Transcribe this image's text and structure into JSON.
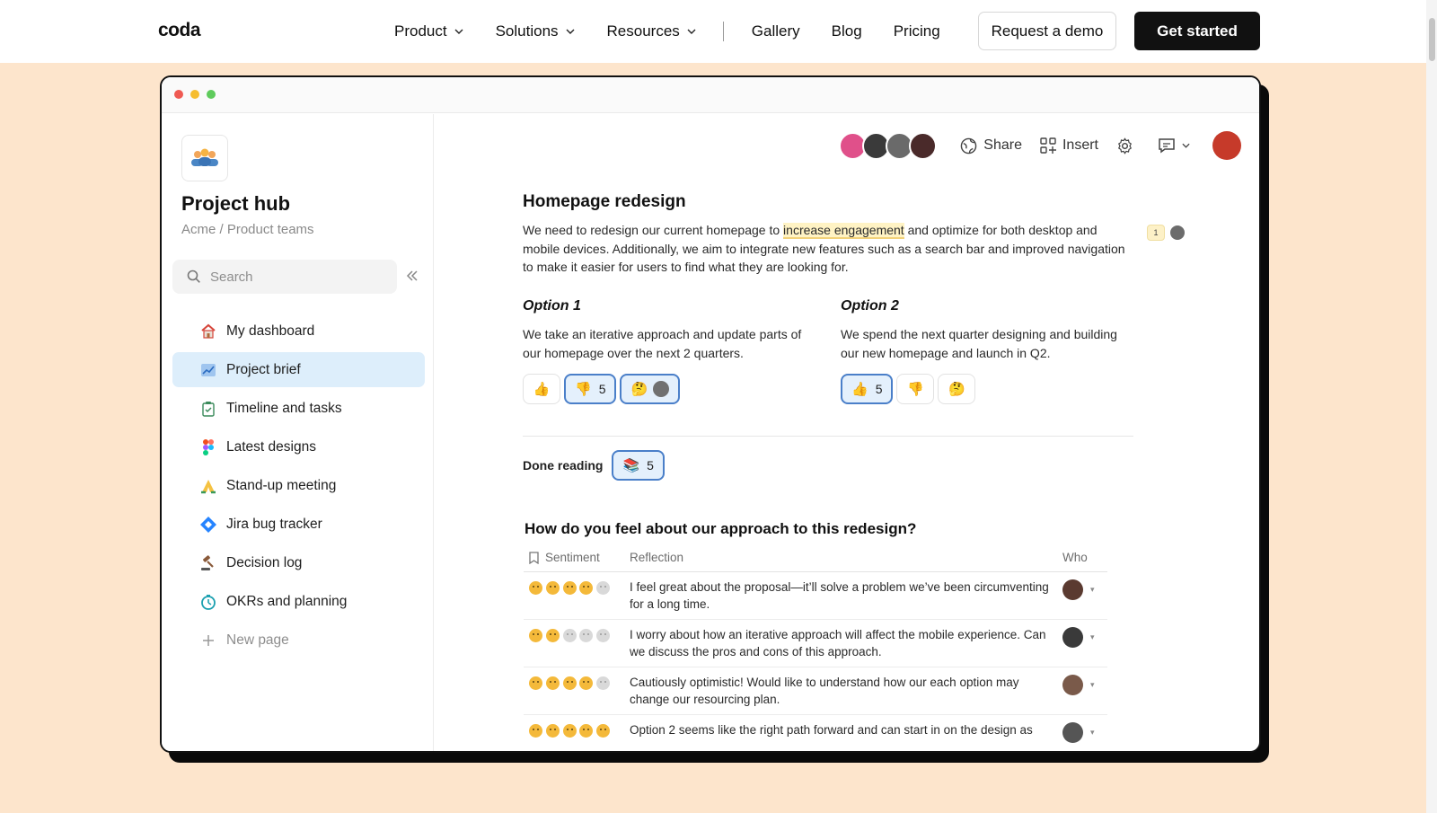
{
  "nav": {
    "logo": "coda",
    "links": [
      {
        "label": "Product",
        "dropdown": true
      },
      {
        "label": "Solutions",
        "dropdown": true
      },
      {
        "label": "Resources",
        "dropdown": true
      },
      {
        "label": "Gallery",
        "dropdown": false
      },
      {
        "label": "Blog",
        "dropdown": false
      },
      {
        "label": "Pricing",
        "dropdown": false
      }
    ],
    "demo_label": "Request a demo",
    "start_label": "Get started"
  },
  "sidebar": {
    "doc_title": "Project hub",
    "doc_subtitle": "Acme / Product teams",
    "search_placeholder": "Search",
    "items": [
      {
        "label": "My dashboard",
        "icon": "house-icon",
        "active": false
      },
      {
        "label": "Project brief",
        "icon": "chart-icon",
        "active": true
      },
      {
        "label": "Timeline and tasks",
        "icon": "clipboard-icon",
        "active": false
      },
      {
        "label": "Latest designs",
        "icon": "figma-icon",
        "active": false
      },
      {
        "label": "Stand-up meeting",
        "icon": "praying-hands-icon",
        "active": false
      },
      {
        "label": "Jira bug tracker",
        "icon": "jira-icon",
        "active": false
      },
      {
        "label": "Decision log",
        "icon": "gavel-icon",
        "active": false
      },
      {
        "label": "OKRs and planning",
        "icon": "stopwatch-icon",
        "active": false
      }
    ],
    "new_page_label": "New page"
  },
  "toolbar": {
    "share_label": "Share",
    "insert_label": "Insert"
  },
  "doc": {
    "title": "Homepage redesign",
    "para_before": "We need to redesign our current homepage to ",
    "para_highlight": "increase engagement",
    "para_after": " and optimize for both desktop and mobile devices. Additionally, we aim to integrate new features such as a search bar and improved navigation to make it easier for users to find what they are looking for.",
    "comment_count": "1",
    "option1": {
      "title": "Option 1",
      "text": "We take an iterative approach and update parts of our homepage over the next 2 quarters.",
      "thumbs_up_emoji": "👍",
      "thumbs_down_emoji": "👎",
      "thumbs_down_count": "5",
      "thinking_emoji": "🤔"
    },
    "option2": {
      "title": "Option 2",
      "text": "We spend the next quarter designing and building our new homepage and launch in Q2.",
      "thumbs_up_emoji": "👍",
      "thumbs_up_count": "5",
      "thumbs_down_emoji": "👎",
      "thinking_emoji": "🤔"
    },
    "done_label": "Done reading",
    "done_emoji": "📚",
    "done_count": "5"
  },
  "feedback": {
    "question": "How do you feel about our approach to this redesign?",
    "headers": {
      "sentiment": "Sentiment",
      "reflection": "Reflection",
      "who": "Who"
    },
    "rows": [
      {
        "sentiment": 4,
        "reflection": "I feel great about the proposal—it’ll solve a problem we’ve been circumventing for a long time.",
        "avatar_color": "#5a3a30"
      },
      {
        "sentiment": 2,
        "reflection": "I worry about how an iterative approach will affect the mobile experience. Can we discuss the pros and cons of this approach.",
        "avatar_color": "#3a3a3a"
      },
      {
        "sentiment": 4,
        "reflection": "Cautiously optimistic! Would like to understand how our each option may change our resourcing plan.",
        "avatar_color": "#7a5a4a"
      },
      {
        "sentiment": 5,
        "reflection": "Option 2 seems like the right path forward and can start in on the design as",
        "avatar_color": "#555555"
      }
    ]
  }
}
